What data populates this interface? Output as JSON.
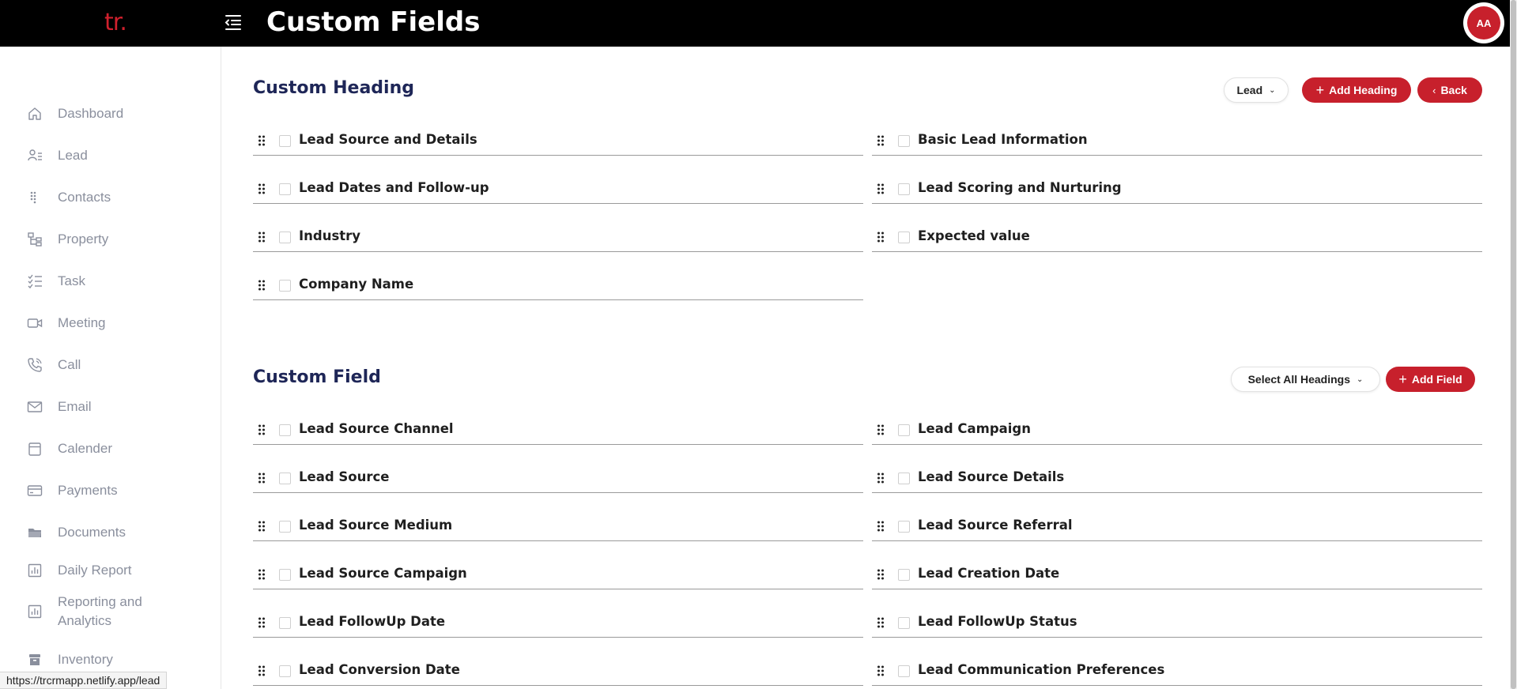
{
  "app": {
    "logo_text": "tr.",
    "page_title": "Custom Fields",
    "avatar_initials": "AA",
    "brand_color": "#c7202c"
  },
  "sidebar": {
    "items": [
      {
        "label": "Dashboard",
        "icon": "home-icon"
      },
      {
        "label": "Lead",
        "icon": "user-list-icon"
      },
      {
        "label": "Contacts",
        "icon": "dialpad-icon"
      },
      {
        "label": "Property",
        "icon": "sitemap-icon"
      },
      {
        "label": "Task",
        "icon": "checklist-icon"
      },
      {
        "label": "Meeting",
        "icon": "video-camera-icon"
      },
      {
        "label": "Call",
        "icon": "phone-icon"
      },
      {
        "label": "Email",
        "icon": "envelope-icon"
      },
      {
        "label": "Calender",
        "icon": "calendar-icon"
      },
      {
        "label": "Payments",
        "icon": "credit-card-icon"
      },
      {
        "label": "Documents",
        "icon": "folder-icon"
      },
      {
        "label": "Daily Report",
        "icon": "bar-chart-icon"
      },
      {
        "label": "Reporting and Analytics",
        "label_line1": "Reporting and",
        "label_line2": "Analytics",
        "icon": "analytics-icon"
      },
      {
        "label": "Inventory",
        "icon": "archive-icon"
      }
    ]
  },
  "custom_heading": {
    "title": "Custom Heading",
    "select_value": "Lead",
    "add_label": "Add Heading",
    "back_label": "Back",
    "left_items": [
      "Lead Source and Details",
      "Lead Dates and Follow-up",
      "Industry",
      "Company Name"
    ],
    "right_items": [
      "Basic Lead Information",
      "Lead Scoring and Nurturing",
      "Expected value"
    ]
  },
  "custom_field": {
    "title": "Custom Field",
    "select_value": "Select All Headings",
    "add_label": "Add Field",
    "left_items": [
      "Lead Source Channel",
      "Lead Source",
      "Lead Source Medium",
      "Lead Source Campaign",
      "Lead FollowUp Date",
      "Lead Conversion Date"
    ],
    "right_items": [
      "Lead Campaign",
      "Lead Source Details",
      "Lead Source Referral",
      "Lead Creation Date",
      "Lead FollowUp Status",
      "Lead Communication Preferences"
    ]
  },
  "status_bar": {
    "url": "https://trcrmapp.netlify.app/lead"
  }
}
